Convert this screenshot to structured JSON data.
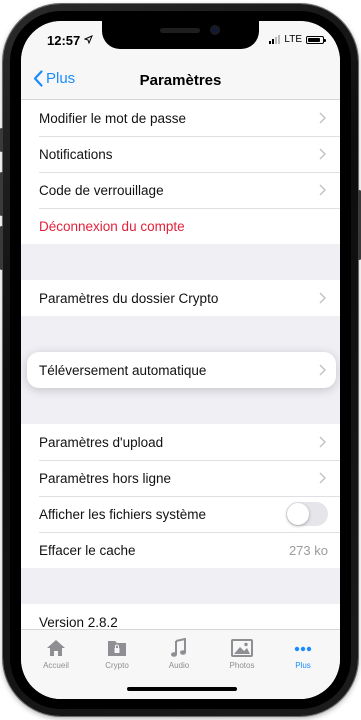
{
  "status_bar": {
    "time": "12:57",
    "network": "LTE",
    "battery_level": 0.85
  },
  "nav": {
    "back_label": "Plus",
    "title": "Paramètres"
  },
  "settings": {
    "change_password": "Modifier le mot de passe",
    "notifications": "Notifications",
    "lock_code": "Code de verrouillage",
    "logout": "Déconnexion du compte",
    "crypto_folder": "Paramètres du dossier Crypto",
    "auto_upload": "Téléversement automatique",
    "upload_settings": "Paramètres d'upload",
    "offline_settings": "Paramètres hors ligne",
    "show_system_files": "Afficher les fichiers système",
    "show_system_files_enabled": false,
    "clear_cache": "Effacer le cache",
    "cache_size": "273 ko",
    "version": "Version 2.8.2"
  },
  "tabs": [
    {
      "label": "Accueil",
      "icon": "home-icon",
      "active": false
    },
    {
      "label": "Crypto",
      "icon": "folder-lock-icon",
      "active": false
    },
    {
      "label": "Audio",
      "icon": "music-note-icon",
      "active": false
    },
    {
      "label": "Photos",
      "icon": "photo-icon",
      "active": false
    },
    {
      "label": "Plus",
      "icon": "more-dots-icon",
      "active": true
    }
  ],
  "colors": {
    "accent": "#1a8cff",
    "danger": "#e3203a",
    "background": "#efeff4"
  }
}
